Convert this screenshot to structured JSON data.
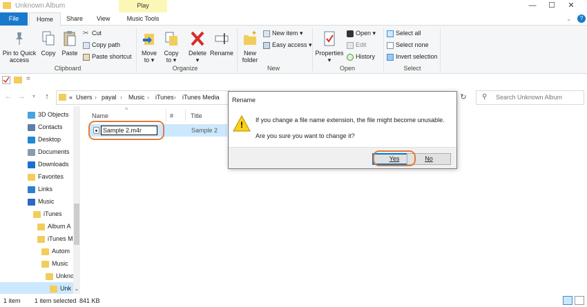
{
  "window": {
    "title": "Unknown Album",
    "minimize_glyph": "—",
    "maximize_glyph": "☐",
    "close_glyph": "✕"
  },
  "ribbon_tabs": {
    "file": "File",
    "home": "Home",
    "share": "Share",
    "view": "View",
    "play_group": "Play",
    "music_tools": "Music Tools"
  },
  "ribbon": {
    "clipboard": {
      "pin": "Pin to Quick access",
      "pin_line1": "Pin to Quick",
      "pin_line2": "access",
      "copy": "Copy",
      "paste": "Paste",
      "cut": "Cut",
      "copy_path": "Copy path",
      "paste_shortcut": "Paste shortcut",
      "group": "Clipboard"
    },
    "organize": {
      "move_to_line1": "Move",
      "move_to_line2": "to ▾",
      "copy_to_line1": "Copy",
      "copy_to_line2": "to ▾",
      "delete": "Delete",
      "delete_arrow": "▾",
      "rename": "Rename",
      "group": "Organize"
    },
    "new": {
      "new_folder_line1": "New",
      "new_folder_line2": "folder",
      "new_item": "New item ▾",
      "easy_access": "Easy access ▾",
      "group": "New"
    },
    "open": {
      "properties": "Properties",
      "properties_arrow": "▾",
      "open": "Open ▾",
      "edit": "Edit",
      "history": "History",
      "group": "Open"
    },
    "select": {
      "select_all": "Select all",
      "select_none": "Select none",
      "invert": "Invert selection",
      "group": "Select"
    }
  },
  "qat": {
    "dropdown": "="
  },
  "address": {
    "back": "←",
    "forward": "→",
    "recent": "▾",
    "up": "↑",
    "chevrons": "«",
    "crumbs": [
      "Users",
      "payal",
      "Music",
      "iTunes",
      "iTunes Media"
    ],
    "separator": "›",
    "refresh": "↻",
    "search_placeholder": "Search Unknown Album"
  },
  "nav_pane": [
    {
      "label": "3D Objects",
      "icon": "cube-icon",
      "color": "#4aa3e0",
      "indent": 40
    },
    {
      "label": "Contacts",
      "icon": "contacts-icon",
      "color": "#5a7fa8",
      "indent": 40
    },
    {
      "label": "Desktop",
      "icon": "desktop-icon",
      "color": "#1e88d6",
      "indent": 40
    },
    {
      "label": "Documents",
      "icon": "documents-icon",
      "color": "#8a9bb0",
      "indent": 40
    },
    {
      "label": "Downloads",
      "icon": "downloads-icon",
      "color": "#1e6fd0",
      "indent": 40
    },
    {
      "label": "Favorites",
      "icon": "star-icon",
      "color": "#f2cd5b",
      "indent": 40
    },
    {
      "label": "Links",
      "icon": "links-icon",
      "color": "#2f7fd0",
      "indent": 40
    },
    {
      "label": "Music",
      "icon": "music-icon",
      "color": "#2f66c4",
      "indent": 40
    },
    {
      "label": "iTunes",
      "icon": "folder-icon",
      "color": "#f2cd5b",
      "indent": 48
    },
    {
      "label": "Album A",
      "icon": "folder-icon",
      "color": "#f2cd5b",
      "indent": 54
    },
    {
      "label": "iTunes M",
      "icon": "folder-icon",
      "color": "#f2cd5b",
      "indent": 54
    },
    {
      "label": "Autom",
      "icon": "folder-icon",
      "color": "#f2cd5b",
      "indent": 60
    },
    {
      "label": "Music",
      "icon": "folder-icon",
      "color": "#f2cd5b",
      "indent": 60
    },
    {
      "label": "Unkno",
      "icon": "folder-icon",
      "color": "#f2cd5b",
      "indent": 66
    },
    {
      "label": "Unk",
      "icon": "folder-icon",
      "color": "#f2cd5b",
      "indent": 72,
      "selected": true
    }
  ],
  "file_list": {
    "col_name": "Name",
    "sort_arrow": "^",
    "col_number": "#",
    "col_title": "Title",
    "rows": [
      {
        "name_editing": "Sample 2.m4r",
        "title": "Sample 2"
      }
    ]
  },
  "dialog": {
    "title": "Rename",
    "warning_glyph": "!",
    "message1": "If you change a file name extension, the file might become unusable.",
    "message2": "Are you sure you want to change it?",
    "yes": "Yes",
    "no": "No"
  },
  "status": {
    "items": "1 item",
    "selected": "1 item selected",
    "size": "841 KB"
  },
  "colors": {
    "accent": "#1979ca",
    "highlight_ring": "#e07b3c",
    "selection": "#cce8ff",
    "play_tab": "#fcf7b6",
    "folder": "#f2cd5b"
  }
}
